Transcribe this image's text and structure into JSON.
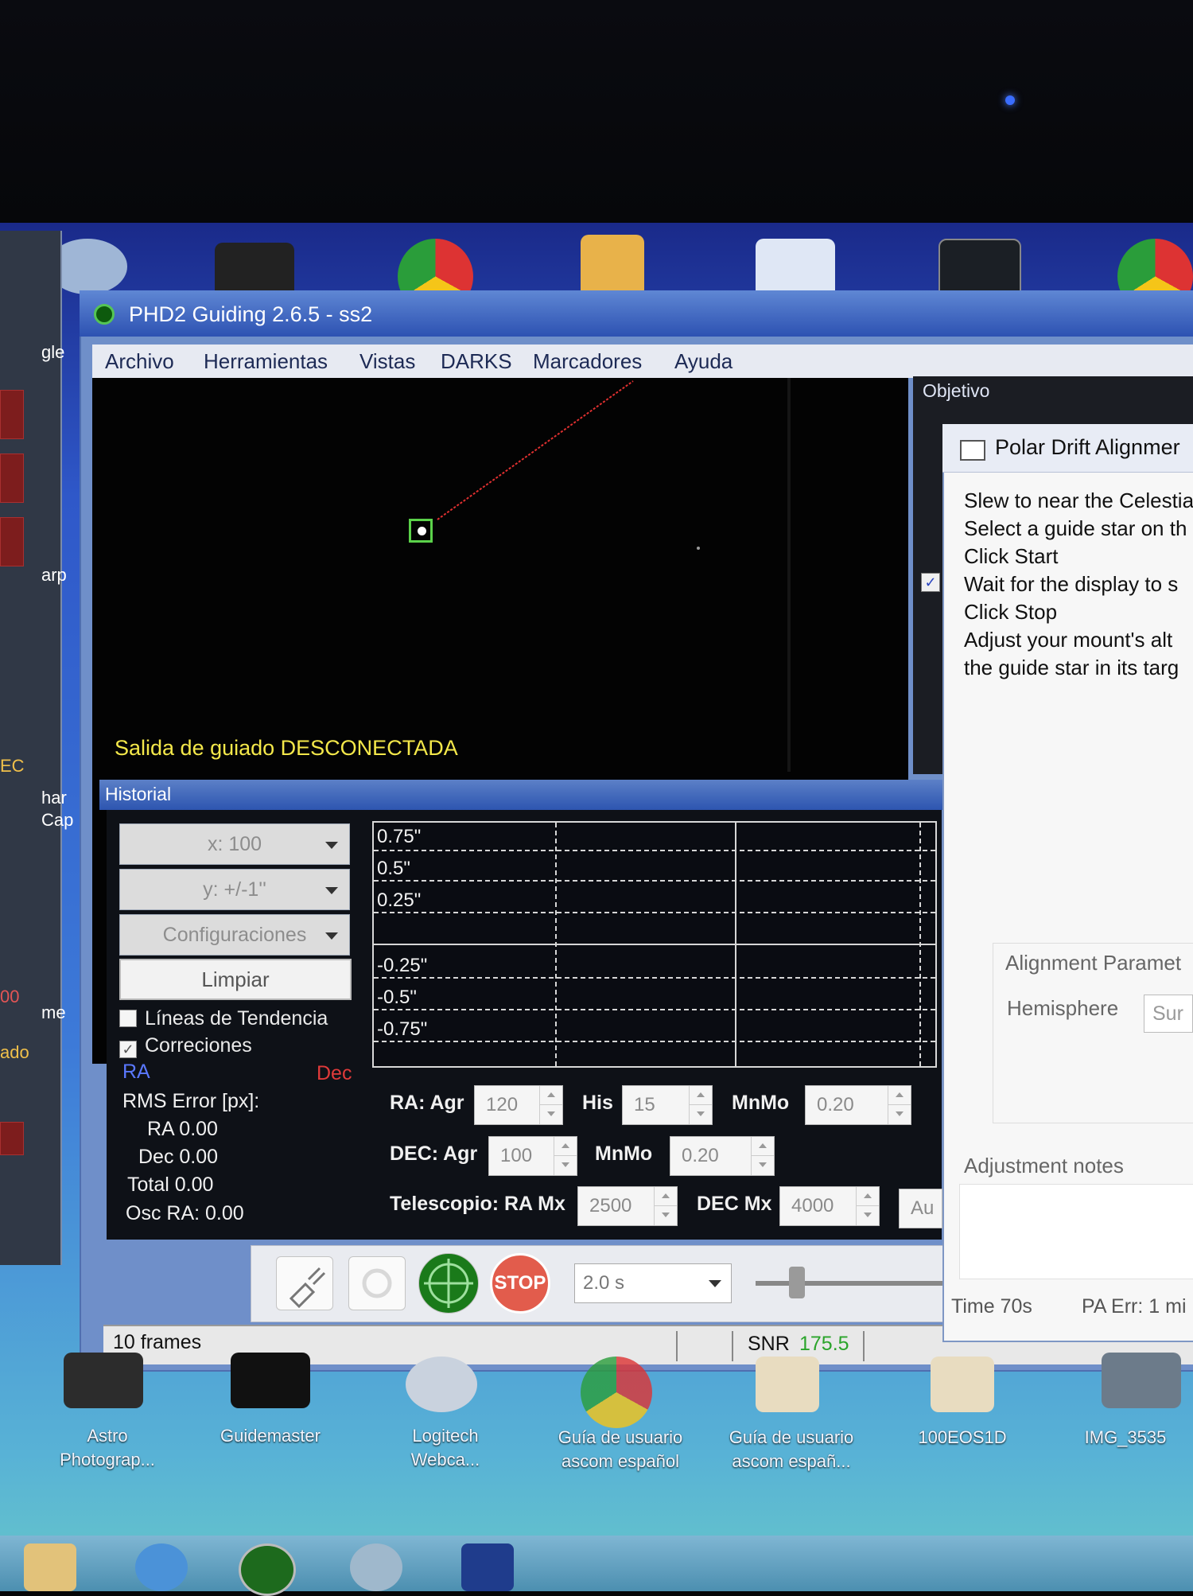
{
  "window": {
    "title": "PHD2 Guiding 2.6.5 - ss2"
  },
  "menu": [
    "Archivo",
    "Herramientas",
    "Vistas",
    "DARKS",
    "Marcadores",
    "Ayuda"
  ],
  "camera": {
    "status": "Salida de guiado DESCONECTADA"
  },
  "objective": {
    "title": "Objetivo"
  },
  "history": {
    "title": "Historial",
    "x_scale": "x: 100",
    "y_scale": "y: +/-1''",
    "settings": "Configuraciones",
    "clear": "Limpiar",
    "trend_lines": "Líneas de Tendencia",
    "corrections": "Correciones",
    "ra_label": "RA",
    "dec_label": "Dec",
    "rms_title": "RMS Error [px]:",
    "rms_ra": "RA 0.00",
    "rms_dec": "Dec 0.00",
    "rms_total": "Total 0.00",
    "osc_ra": "Osc RA: 0.00",
    "graph_labels": [
      "0.75\"",
      "0.5\"",
      "0.25\"",
      "-0.25\"",
      "-0.5\"",
      "-0.75\""
    ]
  },
  "params": {
    "ra_agr_label": "RA: Agr",
    "ra_agr": "120",
    "his_label": "His",
    "his": "15",
    "mnmo_label": "MnMo",
    "mnmo_ra": "0.20",
    "dec_agr_label": "DEC: Agr",
    "dec_agr": "100",
    "mnmo_dec": "0.20",
    "telescope_label": "Telescopio: RA Mx",
    "ra_mx": "2500",
    "dec_mx_label": "DEC Mx",
    "dec_mx": "4000",
    "auto_label": "Au"
  },
  "toolbar": {
    "stop": "STOP",
    "exposure": "2.0 s"
  },
  "statusbar": {
    "frames": "10 frames",
    "snr_label": "SNR",
    "snr_value": "175.5"
  },
  "polar": {
    "title": "Polar Drift Alignmer",
    "lines": [
      "Slew to near the Celestia",
      "Select a guide star on th",
      "Click Start",
      "Wait for the display to s",
      "Click Stop",
      "Adjust your mount's alt",
      "the guide star in its targ"
    ],
    "params_title": "Alignment Paramet",
    "hemisphere_label": "Hemisphere",
    "hemisphere_value": "Sur",
    "notes": "Adjustment notes",
    "time": "Time 70s",
    "pa_err": "PA Err: 1 mi"
  },
  "desktop_icons": [
    {
      "label1": "Astro",
      "label2": "Photograp..."
    },
    {
      "label1": "Guidemaster",
      "label2": ""
    },
    {
      "label1": "Logitech",
      "label2": "Webca..."
    },
    {
      "label1": "Guía de usuario",
      "label2": "ascom español"
    },
    {
      "label1": "Guía de usuario",
      "label2": "ascom españ..."
    },
    {
      "label1": "100EOS1D",
      "label2": ""
    },
    {
      "label1": "IMG_3535",
      "label2": ""
    }
  ],
  "left_fragments": {
    "a": "gle",
    "b": "arp",
    "c": "har",
    "d": "Cap",
    "e": "me",
    "f": "ado",
    "g": "00",
    "h": "EC"
  }
}
